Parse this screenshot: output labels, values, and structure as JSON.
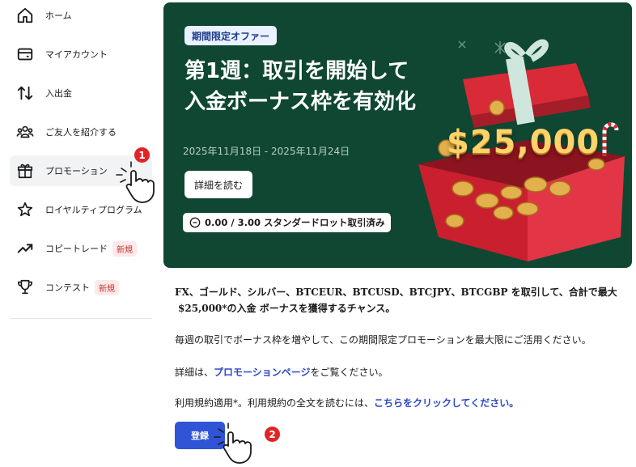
{
  "sidebar": {
    "items": [
      {
        "label": "ホーム",
        "icon": "home-icon"
      },
      {
        "label": "マイアカウント",
        "icon": "wallet-icon"
      },
      {
        "label": "入出金",
        "icon": "transfer-arrows-icon"
      },
      {
        "label": "ご友人を紹介する",
        "icon": "people-icon"
      },
      {
        "label": "プロモーション",
        "icon": "gift-icon",
        "active": true
      },
      {
        "label": "ロイヤルティプログラム",
        "icon": "star-icon"
      },
      {
        "label": "コピートレード",
        "icon": "trend-up-icon",
        "badge": "新規"
      },
      {
        "label": "コンテスト",
        "icon": "trophy-icon",
        "badge": "新規"
      }
    ]
  },
  "banner": {
    "tag": "期間限定オファー",
    "title_line1": "第1週：取引を開始して",
    "title_line2": "入金ボーナス枠を有効化",
    "dates": "2025年11月18日 - 2025年11月24日",
    "details_button": "詳細を読む",
    "lot_progress": "0.00 / 3.00 スタンダードロット取引済み",
    "amount": "$25,000",
    "colors": {
      "background": "#0f4733",
      "accent": "#ffd36a"
    }
  },
  "description": {
    "bold_line1": "FX、ゴールド、シルバー、BTCEUR、BTCUSD、BTCJPY、BTCGBP を取引して、合計で最大",
    "bold_line2": "$25,000*の入金 ボーナスを獲得するチャンス。",
    "para1": "毎週の取引でボーナス枠を増やして、この期間限定プロモーションを最大限にご活用ください。",
    "para2_prefix": "詳細は、",
    "para2_link": "プロモーションページ",
    "para2_suffix": "をご覧ください。",
    "para3_prefix": "利用規約適用*。利用規約の全文を読むには、",
    "para3_link": "こちらをクリックしてください。"
  },
  "register_button": "登録",
  "annotations": {
    "step1": "1",
    "step2": "2"
  }
}
